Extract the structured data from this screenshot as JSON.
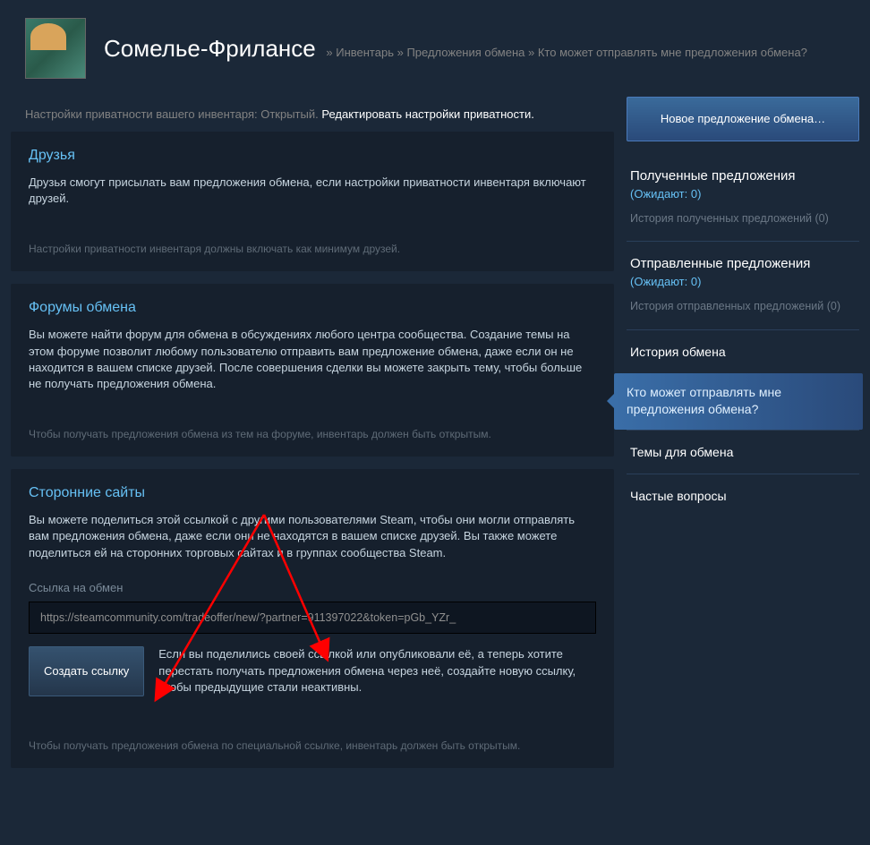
{
  "header": {
    "username": "Сомелье-Фрилансе",
    "crumbs": {
      "sep": "»",
      "c1": "Инвентарь",
      "c2": "Предложения обмена",
      "c3": "Кто может отправлять мне предложения обмена?"
    }
  },
  "privacy": {
    "text": "Настройки приватности вашего инвентаря: Открытый.",
    "link": "Редактировать настройки приватности."
  },
  "cards": {
    "friends": {
      "title": "Друзья",
      "body": "Друзья смогут присылать вам предложения обмена, если настройки приватности инвентаря включают друзей.",
      "hint": "Настройки приватности инвентаря должны включать как минимум друзей."
    },
    "forums": {
      "title": "Форумы обмена",
      "body": "Вы можете найти форум для обмена в обсуждениях любого центра сообщества. Создание темы на этом форуме позволит любому пользователю отправить вам предложение обмена, даже если он не находится в вашем списке друзей. После совершения сделки вы можете закрыть тему, чтобы больше не получать предложения обмена.",
      "hint": "Чтобы получать предложения обмена из тем на форуме, инвентарь должен быть открытым."
    },
    "thirdparty": {
      "title": "Сторонние сайты",
      "body": "Вы можете поделиться этой ссылкой с другими пользователями Steam, чтобы они могли отправлять вам предложения обмена, даже если они не находятся в вашем списке друзей. Вы также можете поделиться ей на сторонних торговых сайтах и в группах сообщества Steam.",
      "url_label": "Ссылка на обмен",
      "url_value": "https://steamcommunity.com/tradeoffer/new/?partner=911397022&token=pGb_YZr_",
      "btn": "Создать ссылку",
      "btn_note": "Если вы поделились своей ссылкой или опубликовали её, а теперь хотите перестать получать предложения обмена через неё, создайте новую ссылку, чтобы предыдущие стали неактивны.",
      "hint": "Чтобы получать предложения обмена по специальной ссылке, инвентарь должен быть открытым."
    }
  },
  "sidebar": {
    "new_offer": "Новое предложение обмена…",
    "incoming": {
      "title": "Полученные предложения",
      "pending": "(Ожидают: 0)",
      "history": "История полученных предложений (0)"
    },
    "sent": {
      "title": "Отправленные предложения",
      "pending": "(Ожидают: 0)",
      "history": "История отправленных предложений (0)"
    },
    "links": {
      "history": "История обмена",
      "who": "Кто может отправлять мне предложения обмена?",
      "topics": "Темы для обмена",
      "faq": "Частые вопросы"
    }
  }
}
